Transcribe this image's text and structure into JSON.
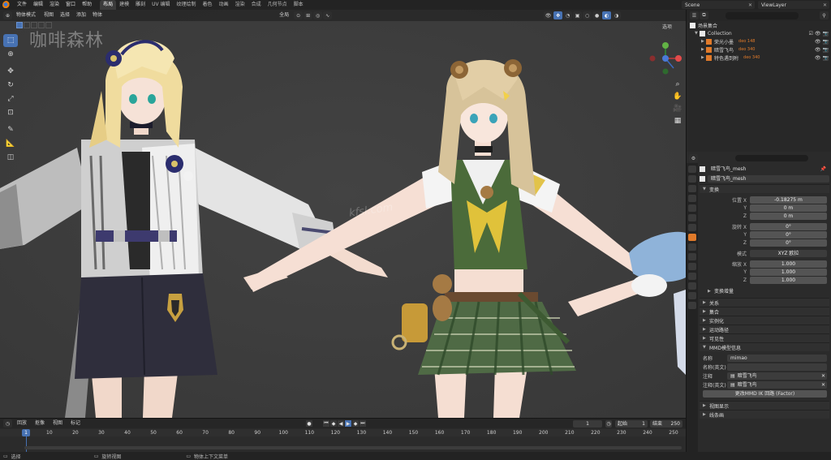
{
  "topbar": {
    "menus": [
      "文件",
      "编辑",
      "渲染",
      "窗口",
      "帮助"
    ],
    "workspaces": [
      "布局",
      "建模",
      "雕刻",
      "UV 编辑",
      "纹理绘制",
      "着色",
      "动画",
      "渲染",
      "合成",
      "几何节点",
      "脚本"
    ],
    "active_workspace": "布局",
    "scene": "Scene",
    "view_layer": "ViewLayer"
  },
  "viewport": {
    "mode": "物体模式",
    "menus": [
      "视图",
      "选择",
      "添加",
      "物体"
    ],
    "transform_orientation": "全局",
    "options": "选项",
    "watermark_left": "咖啡森林",
    "watermark_center": "kfsl.com"
  },
  "outliner": {
    "root": "场景集合",
    "collection": "Collection",
    "objects": [
      {
        "name": "荣光小墨",
        "tag": "deo 148"
      },
      {
        "name": "暗雪飞鸟",
        "tag": "deo 340"
      },
      {
        "name": "特色遇到附",
        "tag": "deo 340"
      }
    ]
  },
  "properties": {
    "object_name": "暗雪飞鸟_mesh",
    "data_name": "暗雪飞鸟_mesh",
    "transform_header": "变换",
    "location_label": "位置 X",
    "location": [
      "-0.18275 m",
      "0 m",
      "0 m"
    ],
    "rotation_label": "旋转 X",
    "rotation": [
      "0°",
      "0°",
      "0°"
    ],
    "mode_label": "模式",
    "rotation_mode": "XYZ 欧拉",
    "scale_label": "缩放 X",
    "scale": [
      "1.000",
      "1.000",
      "1.000"
    ],
    "axis_y": "Y",
    "axis_z": "Z",
    "delta_header": "变换增量",
    "panels": [
      "关系",
      "集合",
      "实例化",
      "运动路径",
      "可见性"
    ],
    "mmd_header": "MMD模型信息",
    "mmd_name_label": "名称",
    "mmd_name": "mimao",
    "mmd_name_en_label": "名称(英文)",
    "mmd_comment_label": "注释",
    "mmd_comment": "暗雪飞鸟",
    "mmd_comment_en_label": "注释(英文)",
    "mmd_comment_en": "暗雪飞鸟",
    "mmd_button": "更改MMD IK 回路 (Factor)",
    "bottom_panels": [
      "视图显示",
      "线条画"
    ]
  },
  "timeline": {
    "menus": [
      "回放",
      "抠像",
      "视图",
      "标记"
    ],
    "current_frame": "1",
    "start_label": "起始",
    "start": "1",
    "end_label": "结束",
    "end": "250",
    "ticks": [
      10,
      20,
      30,
      40,
      50,
      60,
      70,
      80,
      90,
      100,
      110,
      120,
      130,
      140,
      150,
      160,
      170,
      180,
      190,
      200,
      210,
      220,
      230,
      240,
      250
    ]
  },
  "statusbar": {
    "items": [
      "选择",
      "旋转视图",
      "物体上下文菜单"
    ]
  },
  "colors": {
    "accent": "#4772b3",
    "object_orange": "#e07a2a"
  }
}
